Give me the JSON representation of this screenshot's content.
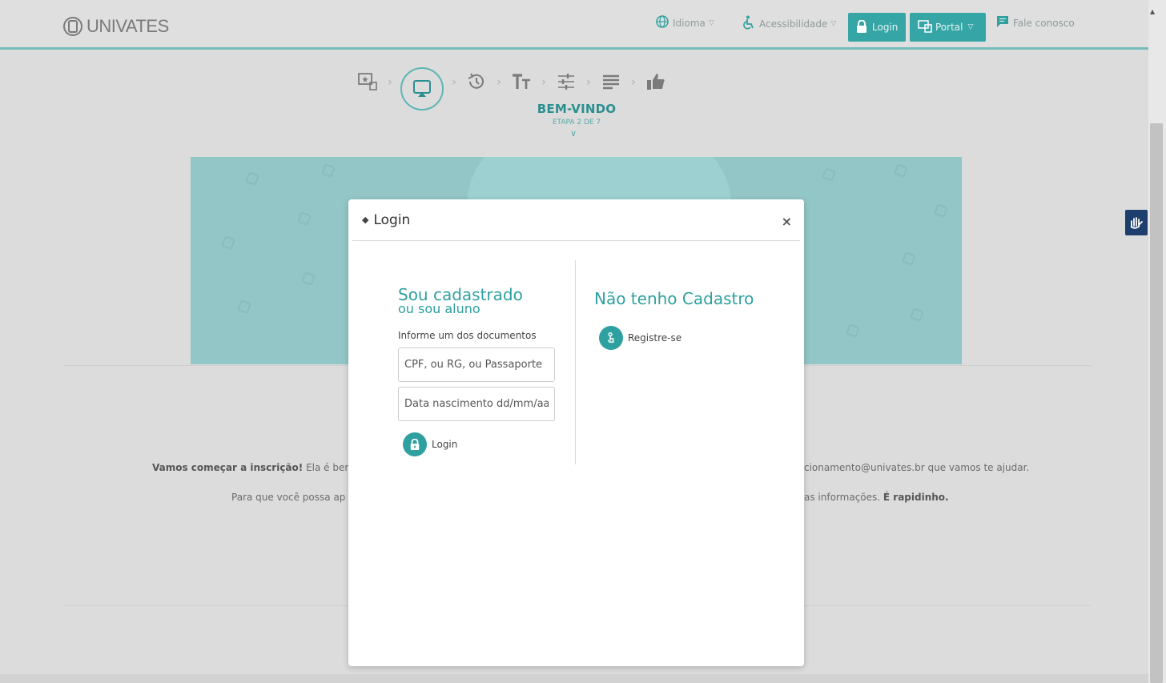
{
  "header": {
    "logo": "UNIVATES",
    "idioma": "Idioma",
    "acessibilidade": "Acessibilidade",
    "login": "Login",
    "portal": "Portal",
    "fale": "Fale conosco"
  },
  "steps": {
    "title": "BEM-VINDO",
    "subtitle": "ETAPA 2 DE 7",
    "icons": [
      "screen-star-icon",
      "screen-touch-icon",
      "history-icon",
      "text-size-icon",
      "sliders-icon",
      "list-icon",
      "thumbs-up-icon"
    ]
  },
  "page": {
    "p1_bold": "Vamos começar a inscrição!",
    "p1_rest": " Ela é ber",
    "p1_right": "cionamento@univates.br que vamos te ajudar.",
    "p2_left": "Para que você possa ap",
    "p2_right": "as informações. ",
    "p2_right_bold": "É rapidinho."
  },
  "modal": {
    "title": "Login",
    "close": "×",
    "left_heading": "Sou cadastrado",
    "left_sub": "ou sou aluno",
    "docs_label": "Informe um dos documentos",
    "doc_placeholder": "CPF, ou RG, ou Passaporte",
    "date_placeholder": "Data nascimento dd/mm/aaaa",
    "login_link": "Login",
    "right_heading": "Não tenho Cadastro",
    "register_link": "Registre-se"
  },
  "colors": {
    "accent": "#2fa0a0",
    "banner": "#93c6c6",
    "libras": "#1e3e6e"
  }
}
